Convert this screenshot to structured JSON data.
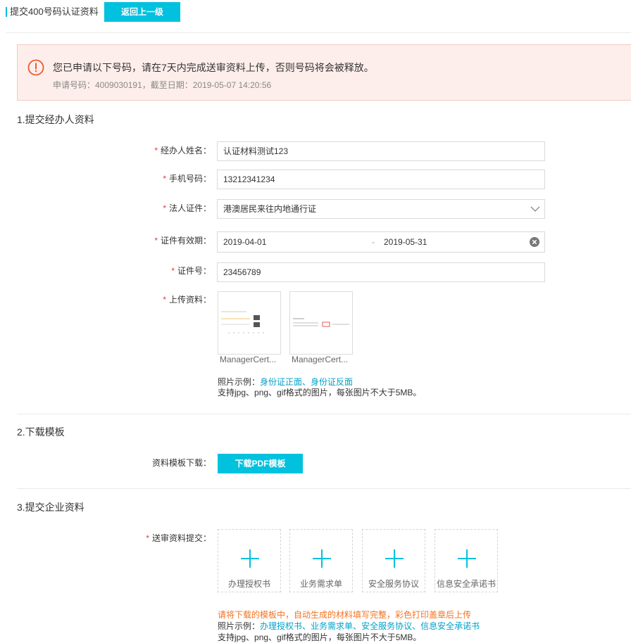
{
  "header": {
    "title": "提交400号码认证资料",
    "back_label": "返回上一级"
  },
  "alert": {
    "message": "您已申请以下号码，请在7天内完成送审资料上传，否则号码将会被释放。",
    "detail": "申请号码：4009030191，截至日期：2019-05-07 14:20:56"
  },
  "section1": {
    "title": "1.提交经办人资料",
    "fields": {
      "name": {
        "label": "经办人姓名：",
        "value": "认证材料测试123"
      },
      "phone": {
        "label": "手机号码：",
        "value": "13212341234"
      },
      "id_type": {
        "label": "法人证件：",
        "value": "港澳居民来往内地通行证"
      },
      "validity": {
        "label": "证件有效期：",
        "start": "2019-04-01",
        "sep": "-",
        "end": "2019-05-31"
      },
      "id_no": {
        "label": "证件号：",
        "value": "23456789"
      },
      "upload": {
        "label": "上传资料："
      }
    },
    "thumbs": [
      {
        "caption": "ManagerCert..."
      },
      {
        "caption": "ManagerCert..."
      }
    ],
    "example_prefix": "照片示例：",
    "example_links": [
      "身份证正面",
      "、",
      "身份证反面"
    ],
    "format_note": "支持jpg、png、gif格式的图片，每张图片不大于5MB。"
  },
  "section2": {
    "title": "2.下载模板",
    "label": "资料模板下载：",
    "button": "下载PDF模板"
  },
  "section3": {
    "title": "3.提交企业资料",
    "label": "送审资料提交：",
    "boxes": [
      "办理授权书",
      "业务需求单",
      "安全服务协议",
      "信息安全承诺书"
    ],
    "warning": "请将下载的模板中，自动生成的材料填写完整，彩色打印盖章后上传",
    "example_prefix": "照片示例：",
    "example_links": [
      "办理授权书",
      "、",
      "业务需求单",
      "、",
      "安全服务协议",
      "、",
      "信息安全承诺书"
    ],
    "format_note": "支持jpg、png、gif格式的图片，每张图片不大于5MB。"
  },
  "colors": {
    "accent": "#00c1de",
    "link": "#00a2ca",
    "required": "#e4393c",
    "warning": "#f47321",
    "alert_bg": "#fdeeeb"
  },
  "icons": {
    "alert": "info-circle-icon",
    "dropdown": "chevron-down-icon",
    "clear": "clear-circle-icon",
    "add": "plus-icon"
  }
}
